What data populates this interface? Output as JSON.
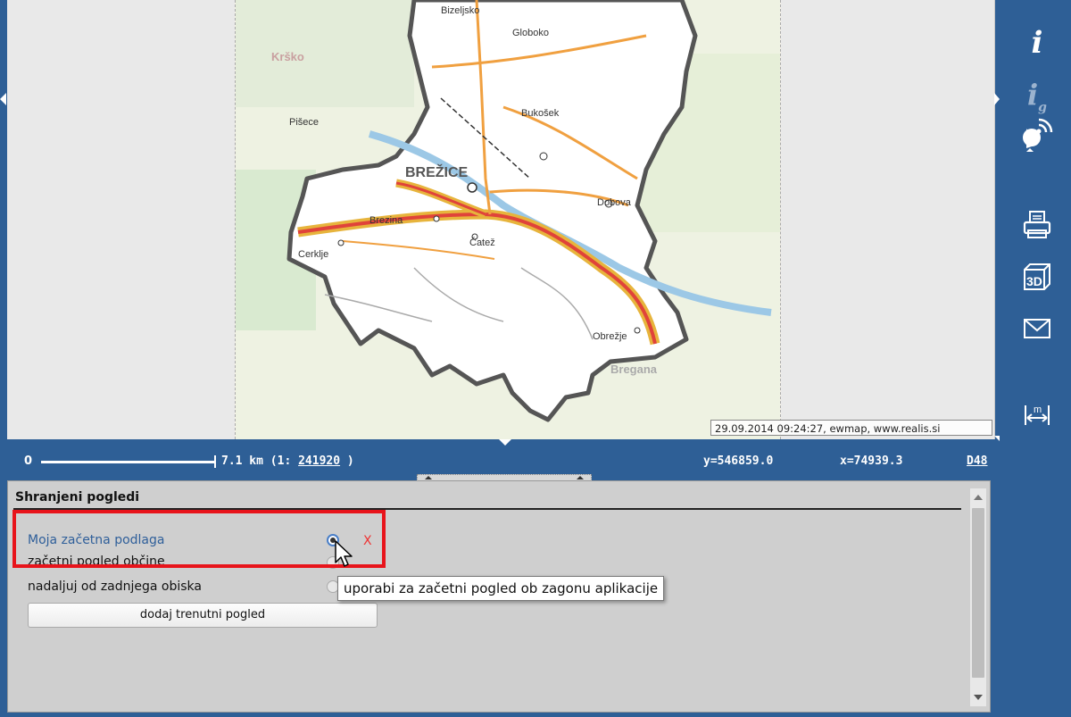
{
  "map": {
    "attribution": "29.09.2014 09:24:27, ewmap, www.realis.si",
    "place_labels": [
      "BREŽICE",
      "Krško",
      "Dobova",
      "Čatež",
      "Obrežje",
      "Globoko",
      "Bukošek",
      "Cerklje",
      "Brezina",
      "Bregana",
      "Pišece",
      "Bizeljsko"
    ]
  },
  "toolbar": {
    "info_label": "i",
    "info_g_label": "i",
    "info_g_sub": "g"
  },
  "status": {
    "scale_zero": "0",
    "scale_distance": "7.1 km (1: ",
    "scale_ratio": "241920",
    "scale_close": " )",
    "y": "y=546859.0",
    "x": "x=74939.3",
    "crs": "D48"
  },
  "panel": {
    "title": "Shranjeni pogledi",
    "views": [
      {
        "label": "Moja začetna podlaga",
        "checked": true,
        "deletable": true
      },
      {
        "label": "začetni pogled občine",
        "checked": false,
        "deletable": false
      },
      {
        "label": "nadaljuj od zadnjega obiska",
        "checked": false,
        "deletable": false
      }
    ],
    "delete_label": "X",
    "add_button": "dodaj trenutni pogled",
    "tooltip": "uporabi za začetni pogled ob zagonu aplikacije"
  }
}
